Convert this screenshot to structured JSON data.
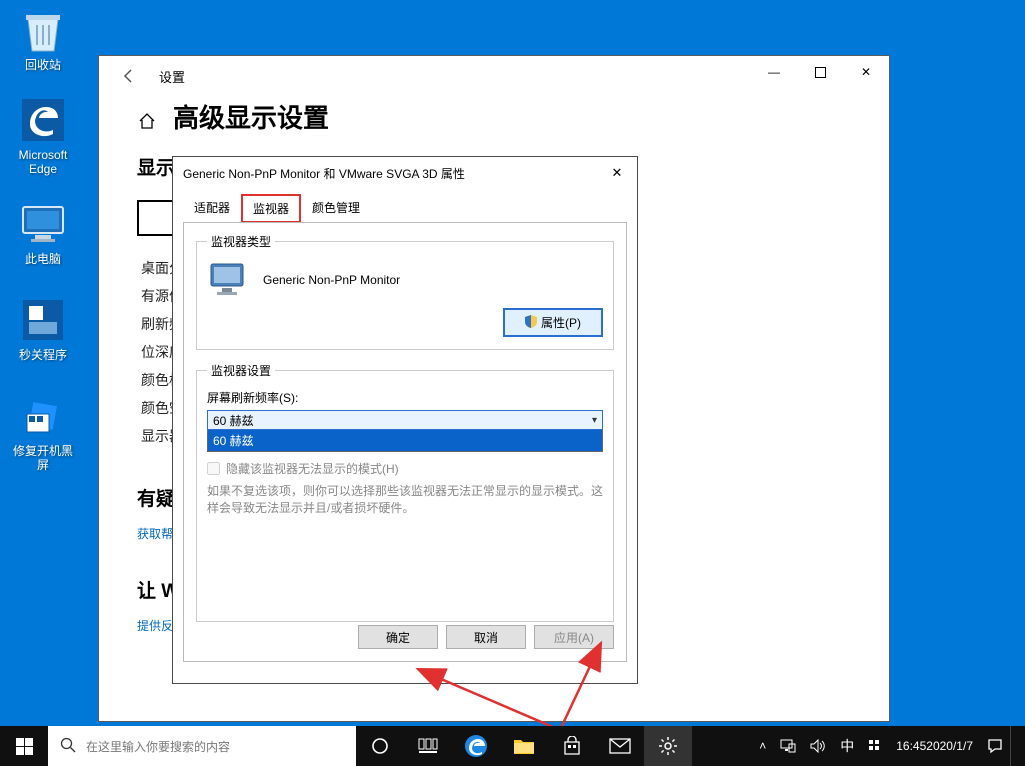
{
  "desktop": {
    "icons": [
      {
        "label": "回收站"
      },
      {
        "label": "Microsoft Edge"
      },
      {
        "label": "此电脑"
      },
      {
        "label": "秒关程序"
      },
      {
        "label": "修复开机黑屏"
      }
    ]
  },
  "settings_window": {
    "title": "设置",
    "heading": "高级显示设置",
    "subheading": "显示信息",
    "info_lines": [
      "桌面分",
      "有源信",
      "刷新频",
      "位深度",
      "颜色格",
      "颜色空"
    ],
    "adapter_link": "显示器",
    "ask_heading": "有疑问",
    "help_link": "获取帮助",
    "better_heading": "让 Wi",
    "feedback_link": "提供反馈"
  },
  "props_dialog": {
    "title": "Generic Non-PnP Monitor 和 VMware SVGA 3D 属性",
    "tabs": {
      "adapter": "适配器",
      "monitor": "监视器",
      "color": "颜色管理"
    },
    "monitor_type_legend": "监视器类型",
    "monitor_name": "Generic Non-PnP Monitor",
    "props_btn": "属性(P)",
    "monitor_settings_legend": "监视器设置",
    "refresh_label": "屏幕刷新频率(S):",
    "refresh_selected": "60 赫兹",
    "refresh_options": [
      "60 赫兹"
    ],
    "hide_modes_label": "隐藏该监视器无法显示的模式(H)",
    "hide_modes_desc": "如果不复选该项，则你可以选择那些该监视器无法正常显示的显示模式。这样会导致无法显示并且/或者损坏硬件。",
    "ok_btn": "确定",
    "cancel_btn": "取消",
    "apply_btn": "应用(A)"
  },
  "taskbar": {
    "search_placeholder": "在这里输入你要搜索的内容",
    "ime": "中",
    "time": "16:45",
    "date": "2020/1/7"
  },
  "colors": {
    "accent": "#0078d7",
    "highlight_red": "#e03030"
  }
}
